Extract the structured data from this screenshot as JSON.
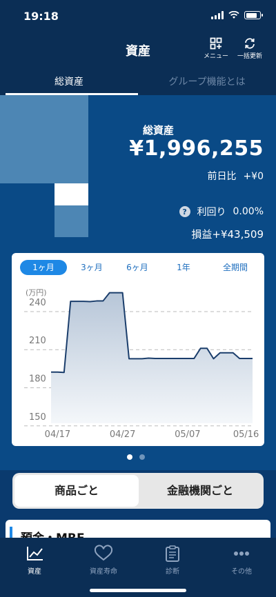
{
  "status": {
    "time": "19:18"
  },
  "header": {
    "title": "資産",
    "menu_label": "メニュー",
    "refresh_label": "一括更新"
  },
  "tabs": [
    {
      "label": "総資産"
    },
    {
      "label": "グループ機能とは"
    }
  ],
  "summary": {
    "label": "総資産",
    "amount": "¥1,996,255",
    "diff_label": "前日比",
    "diff_value": "+¥0",
    "yield_label": "利回り",
    "yield_value": "0.00%",
    "pnl_label": "損益",
    "pnl_value": "+¥43,509"
  },
  "periods": [
    "1ヶ月",
    "3ヶ月",
    "6ヶ月",
    "1年",
    "全期間"
  ],
  "colors": {
    "accent": "#1e88e5",
    "navy": "#0b2e55",
    "panel": "#0a4a86"
  },
  "chart_data": {
    "type": "area",
    "ylabel": "(万円)",
    "yticks": [
      240,
      210,
      180,
      150
    ],
    "ylim": [
      145,
      253
    ],
    "xticks": [
      {
        "label": "04/17",
        "i": 1
      },
      {
        "label": "04/27",
        "i": 11
      },
      {
        "label": "05/07",
        "i": 21
      },
      {
        "label": "05/16",
        "i": 30
      }
    ],
    "series": [
      {
        "values": [
          185.3,
          185.3,
          185.0,
          241.0,
          241.0,
          241.0,
          240.8,
          241.3,
          241.3,
          247.8,
          247.8,
          247.8,
          195.8,
          195.8,
          195.8,
          196.3,
          196.0,
          196.0,
          196.0,
          196.0,
          196.0,
          196.0,
          196.0,
          204.0,
          204.0,
          195.8,
          200.5,
          200.5,
          200.5,
          196.0,
          196.0,
          196.0
        ]
      }
    ]
  },
  "pager": {
    "active": 0,
    "count": 2
  },
  "segment": [
    {
      "label": "商品ごと"
    },
    {
      "label": "金融機関ごと"
    }
  ],
  "list": {
    "first_title": "預金・MRF"
  },
  "bottom_nav": [
    {
      "label": "資産",
      "icon": "chart-line-icon"
    },
    {
      "label": "資産寿命",
      "icon": "heart-icon"
    },
    {
      "label": "診断",
      "icon": "clipboard-icon"
    },
    {
      "label": "その他",
      "icon": "more-icon"
    }
  ]
}
